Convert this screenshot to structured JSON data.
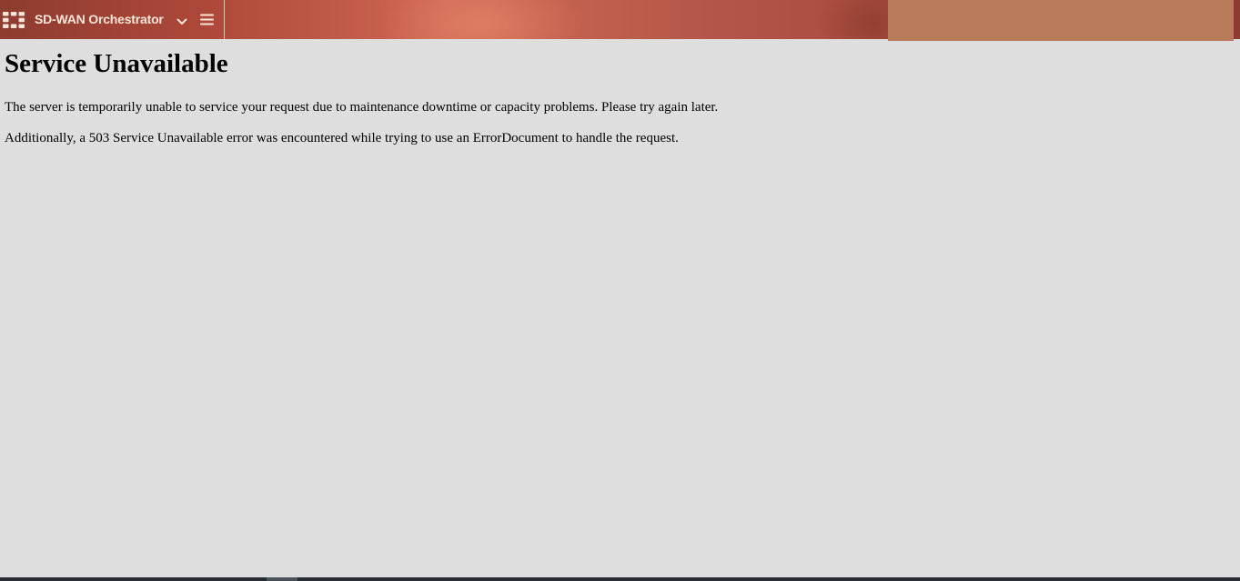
{
  "header": {
    "app_title": "SD-WAN Orchestrator",
    "logo_icon": "fortinet-grid-logo-icon",
    "dropdown_icon": "chevron-down-icon",
    "menu_icon": "hamburger-menu-icon",
    "colors": {
      "bar_base": "#a84a3d",
      "bar_highlight": "#d06a56",
      "title_text": "#fbe5d9",
      "right_panel": "#b97b5c"
    }
  },
  "main": {
    "heading": "Service Unavailable",
    "paragraphs": [
      "The server is temporarily unable to service your request due to maintenance downtime or capacity problems. Please try again later.",
      "Additionally, a 503 Service Unavailable error was encountered while trying to use an ErrorDocument to handle the request."
    ]
  },
  "colors": {
    "page_background": "#dedede",
    "bottom_bar": "#272d33"
  }
}
